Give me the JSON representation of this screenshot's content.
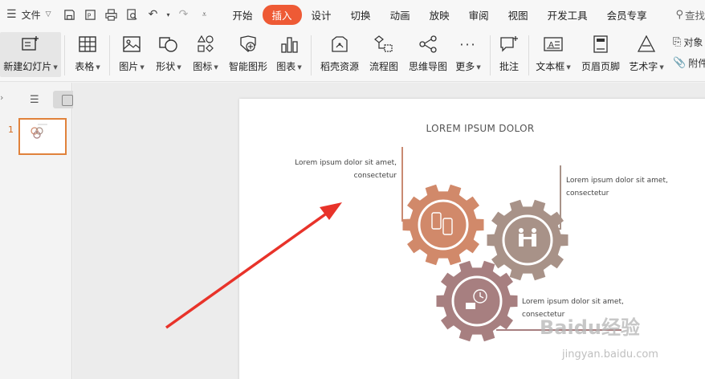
{
  "menubar": {
    "file_label": "文件",
    "tabs": [
      "开始",
      "插入",
      "设计",
      "切换",
      "动画",
      "放映",
      "审阅",
      "视图",
      "开发工具",
      "会员专享"
    ],
    "active_tab": "插入",
    "search_label": "查找"
  },
  "ribbon": {
    "new_slide": "新建幻灯片",
    "table": "表格",
    "picture": "图片",
    "shape": "形状",
    "icon": "图标",
    "smart_art": "智能图形",
    "chart": "图表",
    "docer": "稻壳资源",
    "flowchart": "流程图",
    "mindmap": "思维导图",
    "more": "更多",
    "comment": "批注",
    "textbox": "文本框",
    "header_footer": "页眉页脚",
    "wordart": "艺术字",
    "object": "对象",
    "attachment": "附件"
  },
  "panel": {
    "slide_number": "1"
  },
  "slide": {
    "title": "LOREM IPSUM DOLOR",
    "text1_line1": "Lorem ipsum dolor sit amet,",
    "text1_line2": "consectetur",
    "text2_line1": "Lorem ipsum dolor sit amet,",
    "text2_line2": "consectetur",
    "text3_line1": "Lorem ipsum dolor sit amet,",
    "text3_line2": "consectetur"
  },
  "watermark": {
    "logo": "Baidu经验",
    "url": "jingyan.baidu.com"
  },
  "colors": {
    "accent": "#ee5a35",
    "gear1": "#d1896a",
    "gear2": "#a89288",
    "gear3": "#a77f80",
    "arrow": "#e8332a"
  }
}
